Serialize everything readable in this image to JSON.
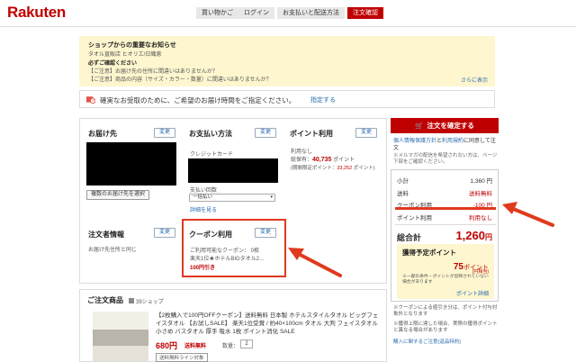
{
  "header": {
    "logo": "Rakuten",
    "crumbs": [
      "買い物かご",
      "ログイン",
      "お支払いと配送方法",
      "注文確認"
    ]
  },
  "notice": {
    "title": "ショップからの重要なお知らせ",
    "shop": "タオル直販店 ヒオリエ/日織恵",
    "check_heading": "必ずご確認ください",
    "line1": "【ご注意】お届け先の住所に間違いはありませんか？",
    "line2": "【ご注意】商品の内容（サイズ・カラー・数量）に間違いはありませんか？",
    "more": "さらに表示"
  },
  "delivery": {
    "text": "確実なお受取のために、ご希望のお届け時間をご指定ください。",
    "link": "指定する"
  },
  "address": {
    "title": "お届け先",
    "change": "変更",
    "multi_button": "複数のお届け先を選択"
  },
  "payment": {
    "title": "お支払い方法",
    "change": "変更",
    "method": "クレジットカード",
    "installments_label": "支払い回数",
    "installments_value": "一括払い",
    "details": "詳細を見る"
  },
  "points": {
    "title": "ポイント利用",
    "change": "変更",
    "usage": "利用なし",
    "held_label": "総保有：",
    "held_value": "40,735",
    "held_unit": "ポイント",
    "limited_label": "(期間限定ポイント：",
    "limited_value": "33,252",
    "limited_unit": "ポイント)"
  },
  "orderer": {
    "title": "注文者情報",
    "change": "変更",
    "value": "お届け先住所と同じ"
  },
  "coupon": {
    "title": "クーポン利用",
    "change": "変更",
    "available": "ご利用可能なクーポン： 0枚",
    "name": "楽天1位★ホテルBIGタオル2…",
    "discount": "100円引き"
  },
  "items": {
    "title": "ご注文商品",
    "shop": "39ショップ",
    "desc": "【2枚購入で100円OFFクーポン】送料無料 日本製 ホテルスタイルタオル ビッグフェイスタオル 【お試しSALE】 楽天1位受賞 / 約40×100cm タオル 大判 フェイスタオル 小さめ バスタオル 厚手 吸水 1枚 ポイント消化 SALE",
    "price": "680円",
    "shipping": "送料無料",
    "qty_label": "数量：",
    "qty": "2",
    "tag": "送料無料ライン対象"
  },
  "sidebar": {
    "confirm": "注文を確定する",
    "agree1": "個人情報保護方針",
    "agree2": "と",
    "agree3": "利用規約",
    "agree4": "に同意して注文",
    "note": "※メルマガの配信を希望されない方は、ページ下部をご確認ください。",
    "subtotal_label": "小計",
    "subtotal": "1,360 円",
    "shipping_label": "送料",
    "shipping": "送料無料",
    "coupon_label": "クーポン利用",
    "coupon": "-100 円",
    "points_label": "ポイント利用",
    "points": "利用なし",
    "total_label": "総合計",
    "total": "1,260",
    "total_unit": "円",
    "earn_title": "獲得予定ポイント",
    "earn_value": "75",
    "earn_unit": "ポイント",
    "earn_multi": "(円相当)",
    "earn_note": "※一部の条件・ポイントが反映されていない場合があります",
    "earn_link": "ポイント詳細",
    "fn1": "※クーポンによる値引き分は、ポイント付与対象外となります",
    "fn2": "※獲得上限に達した場合、実際の獲得ポイントと異なる場合があります",
    "fn3": "購入に関するご注意(返品特約)"
  },
  "colors": {
    "brand": "#bf0000",
    "arrow": "#e0391d",
    "notice_bg": "#fdf6cf",
    "link": "#2a6db0"
  }
}
